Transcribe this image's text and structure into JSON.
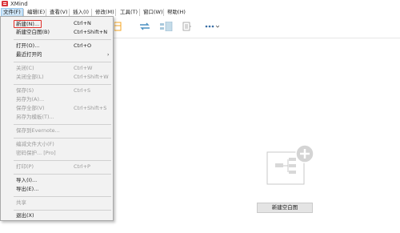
{
  "window": {
    "title": "XMind"
  },
  "menubar": {
    "items": [
      {
        "label": "文件(F)"
      },
      {
        "label": "编辑(E)"
      },
      {
        "label": "查看(V)"
      },
      {
        "label": "插入(I)"
      },
      {
        "label": "修改(M)"
      },
      {
        "label": "工具(T)"
      },
      {
        "label": "窗口(W)"
      },
      {
        "label": "帮助(H)"
      }
    ]
  },
  "toolbar": {
    "icons": [
      "new-topic-icon",
      "relationship-icon",
      "summary-icon",
      "note-icon",
      "more-icon"
    ]
  },
  "file_menu": {
    "items": [
      {
        "label": "新建(N)...",
        "shortcut": "Ctrl+N",
        "enabled": true,
        "highlight": true
      },
      {
        "label": "新建空白图(B)",
        "shortcut": "Ctrl+Shift+N",
        "enabled": true
      },
      {
        "label": "打开(O)...",
        "shortcut": "Ctrl+O",
        "enabled": true
      },
      {
        "label": "最近打开的",
        "shortcut": "",
        "enabled": true,
        "submenu": "›"
      },
      {
        "label": "关闭(C)",
        "shortcut": "Ctrl+W",
        "enabled": false
      },
      {
        "label": "关闭全部(L)",
        "shortcut": "Ctrl+Shift+W",
        "enabled": false
      },
      {
        "label": "保存(S)",
        "shortcut": "Ctrl+S",
        "enabled": false
      },
      {
        "label": "另存为(A)...",
        "shortcut": "",
        "enabled": false
      },
      {
        "label": "保存全部(V)",
        "shortcut": "Ctrl+Shift+S",
        "enabled": false
      },
      {
        "label": "另存为模板(T)...",
        "shortcut": "",
        "enabled": false
      },
      {
        "label": "保存到Evernote...",
        "shortcut": "",
        "enabled": false
      },
      {
        "label": "编减文件大小(F)",
        "shortcut": "",
        "enabled": false
      },
      {
        "label": "密码保护... [Pro]",
        "shortcut": "",
        "enabled": false
      },
      {
        "label": "打印(P)",
        "shortcut": "Ctrl+P",
        "enabled": false
      },
      {
        "label": "导入(I)...",
        "shortcut": "",
        "enabled": true
      },
      {
        "label": "导出(E)...",
        "shortcut": "",
        "enabled": true
      },
      {
        "label": "共享",
        "shortcut": "",
        "enabled": false
      },
      {
        "label": "退出(X)",
        "shortcut": "",
        "enabled": true
      }
    ]
  },
  "canvas": {
    "new_blank_button": "新建空白图"
  },
  "colors": {
    "logo": "#d9363e",
    "highlight_border": "#e0302a",
    "menu_active": "#cce4f7",
    "menu_bg": "#f2f2f2",
    "toolbar_icon_orange": "#f5a623",
    "toolbar_icon_blue": "#4a90c2"
  }
}
